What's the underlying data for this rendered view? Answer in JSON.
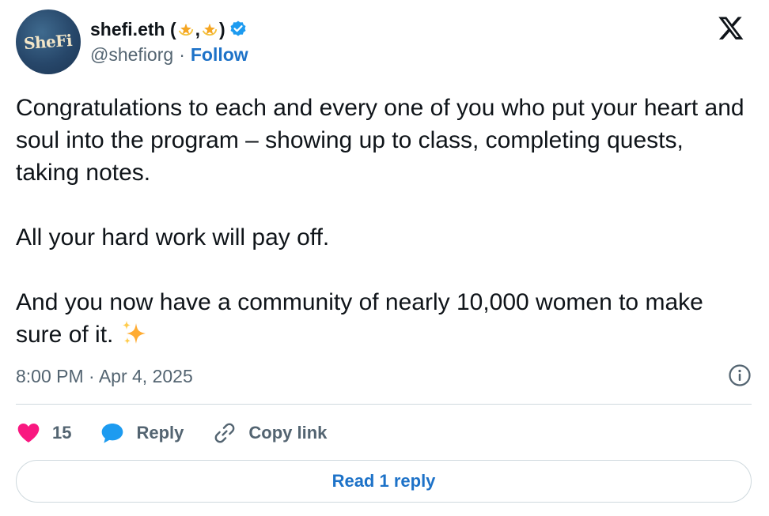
{
  "author": {
    "display_name_prefix": "shefi.eth (",
    "display_name_sep": ",",
    "display_name_suffix": ")",
    "handle": "@shefiorg",
    "separator": "·",
    "follow_label": "Follow",
    "avatar_text": "SheFi",
    "verified_icon": "verified-badge-icon"
  },
  "brand_icon": "x-logo-icon",
  "tweet": {
    "paragraph_1": "Congratulations to each and every one of you who put your heart and soul into the program – showing up to class, completing quests, taking notes.",
    "paragraph_2": "All your hard work will pay off.",
    "paragraph_3": "And you now have a community of nearly 10,000 women to make sure of it.",
    "emoji": "sparkles"
  },
  "timestamp": "8:00 PM · Apr 4, 2025",
  "actions": {
    "like_count": "15",
    "reply_label": "Reply",
    "copy_link_label": "Copy link"
  },
  "read_replies_label": "Read 1 reply",
  "colors": {
    "link_blue": "#1d72c8",
    "like_pink": "#f91880",
    "reply_blue": "#1d9bf0",
    "muted_text": "#536471",
    "border": "#cfd9de"
  }
}
